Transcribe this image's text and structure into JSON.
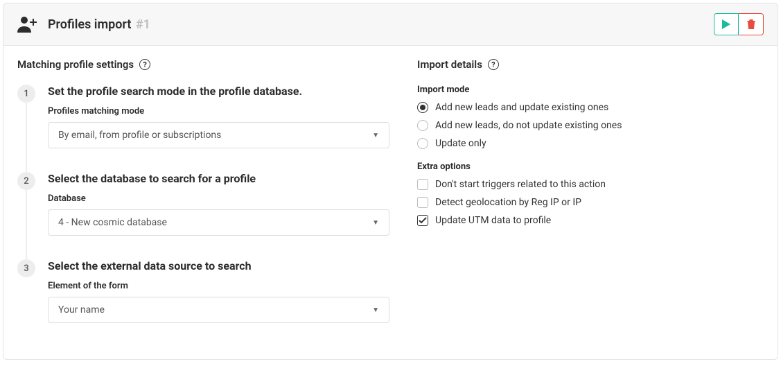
{
  "header": {
    "title": "Profiles import",
    "number": "#1"
  },
  "left": {
    "section_title": "Matching profile settings",
    "steps": [
      {
        "num": "1",
        "heading": "Set the profile search mode in the profile database.",
        "field_label": "Profiles matching mode",
        "field_value": "By email, from profile or subscriptions"
      },
      {
        "num": "2",
        "heading": "Select the database to search for a profile",
        "field_label": "Database",
        "field_value": "4 - New cosmic database"
      },
      {
        "num": "3",
        "heading": "Select the external data source to search",
        "field_label": "Element of the form",
        "field_value": "Your name"
      }
    ]
  },
  "right": {
    "section_title": "Import details",
    "import_mode_label": "Import mode",
    "import_modes": [
      {
        "label": "Add new leads and update existing ones",
        "checked": true
      },
      {
        "label": "Add new leads, do not update existing ones",
        "checked": false
      },
      {
        "label": "Update only",
        "checked": false
      }
    ],
    "extra_label": "Extra options",
    "extras": [
      {
        "label": "Don't start triggers related to this action",
        "checked": false
      },
      {
        "label": "Detect geolocation by Reg IP or IP",
        "checked": false
      },
      {
        "label": "Update UTM data to profile",
        "checked": true
      }
    ]
  }
}
